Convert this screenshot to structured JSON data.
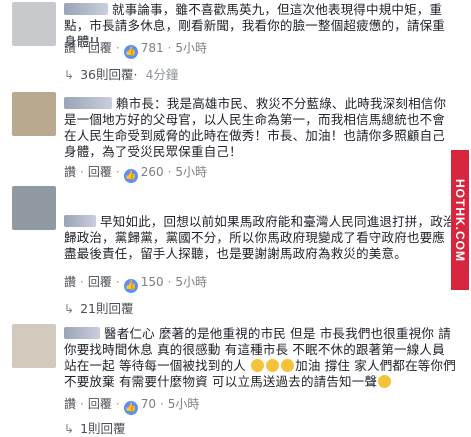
{
  "comments": [
    {
      "text": "就事論事，雖不喜歡馬英九，但這次他表現得中規中矩，重點，市長請多休息，剛看新聞，我看你的臉一整個超疲憊的，請保重身體!!",
      "reply_label": "回覆",
      "likes": "781",
      "time": "5小時",
      "replies_summary": {
        "label": "36則回覆",
        "time": "4分鐘"
      }
    },
    {
      "text": "賴市長：我是高雄市民、救災不分藍綠、此時我深刻相信你是一個地方好的父母官，以人民生命為第一，而我相信馬總統也不會在人民生命受到威脅的此時在做秀！市長、加油！也請你多照顧自己身體，為了受災民眾保重自己！",
      "reply_label": "回覆",
      "likes": "260",
      "time": "5小時"
    },
    {
      "text": "早知如此，回想以前如果馬政府能和臺灣人民同進退打拼，政治歸政治，黨歸黨，黨國不分，所以你馬政府現變成了看守政府也要應盡最後責任，留手人探聽，也是要謝謝馬政府為救災的美意。",
      "reply_label": "回覆",
      "likes": "150",
      "time": "5小時",
      "replies_summary": {
        "label": "21則回覆"
      }
    },
    {
      "text_before_emoji1": "醫者仁心 麼著的是他重視的市民 但是 市長我們也很重視你 請你要找時間休息 真的很感動 有這種市長 不眠不休的跟著第一線人員站在一起 等待每一個被找到的人 ",
      "text_between": "加油 撐住 家人們都在等你們 不要放棄 有需要什麼物資 可以立馬送過去的請告知一聲",
      "reply_label": "回覆",
      "likes": "70",
      "time": "5小時",
      "replies_summary": {
        "label": "1則回覆"
      }
    }
  ],
  "ui": {
    "like_label": "讚",
    "reply_arrow": "↳",
    "dot": "·"
  },
  "watermark": "HOTHK.COM"
}
